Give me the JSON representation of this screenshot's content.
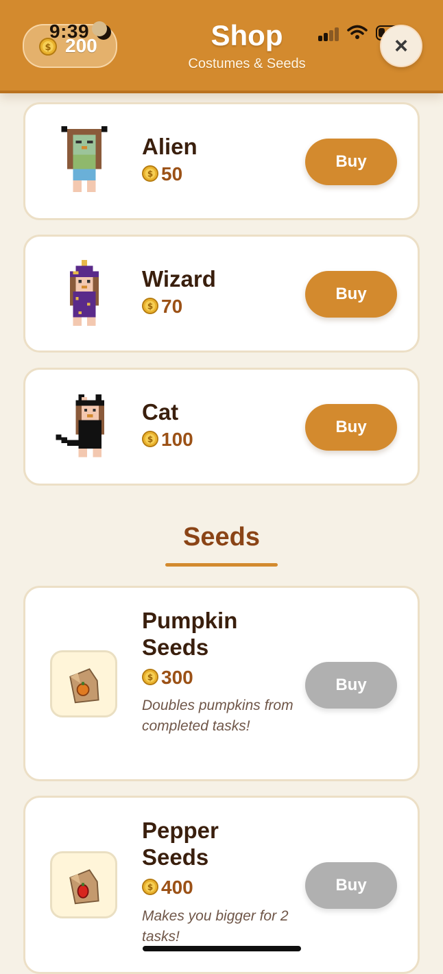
{
  "status_bar": {
    "time": "9:39"
  },
  "header": {
    "coin_balance": "200",
    "title": "Shop",
    "subtitle": "Costumes & Seeds",
    "close_glyph": "×"
  },
  "costumes": [
    {
      "name": "Alien",
      "price": "50",
      "button": "Buy",
      "button_state": "active"
    },
    {
      "name": "Wizard",
      "price": "70",
      "button": "Buy",
      "button_state": "active"
    },
    {
      "name": "Cat",
      "price": "100",
      "button": "Buy",
      "button_state": "active"
    }
  ],
  "seeds_section": {
    "title": "Seeds"
  },
  "seeds": [
    {
      "name_line1": "Pumpkin",
      "name_line2": "Seeds",
      "price": "300",
      "description": "Doubles pumpkins from completed tasks!",
      "button": "Buy",
      "button_state": "disabled",
      "icon": "pumpkin-seed-bag-icon"
    },
    {
      "name_line1": "Pepper",
      "name_line2": "Seeds",
      "price": "400",
      "description": "Makes you bigger for 2 tasks!",
      "button": "Buy",
      "button_state": "disabled",
      "icon": "pepper-seed-bag-icon"
    }
  ],
  "colors": {
    "accent": "#d38a2e",
    "background": "#f6f1e6",
    "price_text": "#9b5116",
    "disabled_button": "#b0b0b0"
  }
}
